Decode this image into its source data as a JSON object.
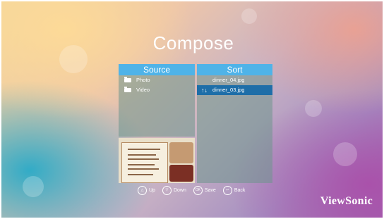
{
  "page": {
    "title": "Compose"
  },
  "source": {
    "header": "Source",
    "items": [
      {
        "label": "Photo",
        "icon": "folder-icon"
      },
      {
        "label": "Video",
        "icon": "folder-icon"
      }
    ]
  },
  "sort": {
    "header": "Sort",
    "items": [
      {
        "label": "dinner_04.jpg",
        "selected": false
      },
      {
        "label": "dinner_03.jpg",
        "selected": true,
        "marker": "↑↓"
      }
    ]
  },
  "hints": [
    {
      "key": "up-key",
      "label": "Up"
    },
    {
      "key": "down-key",
      "label": "Down"
    },
    {
      "key": "ok-key",
      "label": "Save"
    },
    {
      "key": "back-key",
      "label": "Back"
    }
  ],
  "brand": {
    "logo": "ViewSonic"
  }
}
